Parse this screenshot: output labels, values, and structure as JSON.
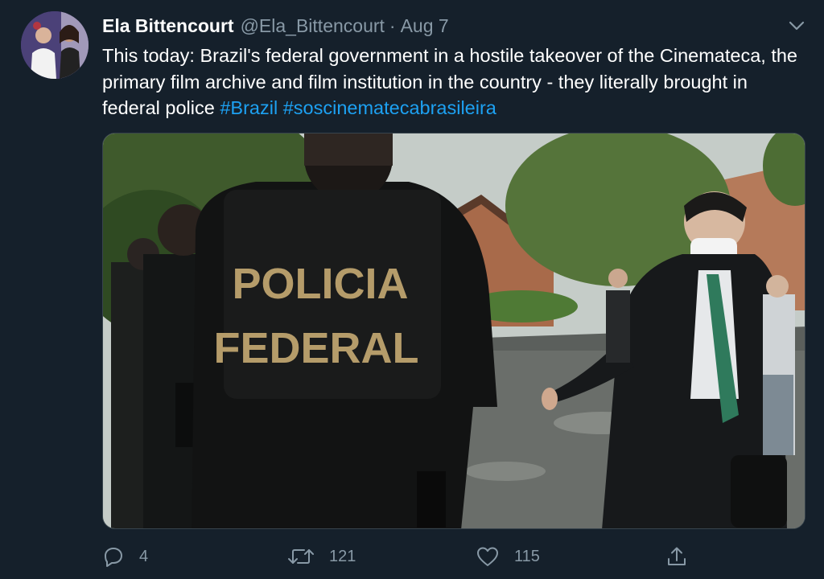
{
  "tweet": {
    "author_name": "Ela Bittencourt",
    "author_handle": "@Ela_Bittencourt",
    "separator": "·",
    "date": "Aug 7",
    "text_main": "This today: Brazil's federal government in a hostile takeover of the Cinemateca, the primary film archive and film institution in the country - they literally brought in federal police ",
    "hashtags": [
      "#Brazil",
      "#soscinematecabrasileira"
    ],
    "media": {
      "vest_text_line1": "POLICIA",
      "vest_text_line2": "FEDERAL"
    },
    "actions": {
      "reply": {
        "icon": "reply-icon",
        "count": "4"
      },
      "retweet": {
        "icon": "retweet-icon",
        "count": "121"
      },
      "like": {
        "icon": "heart-icon",
        "count": "115"
      },
      "share": {
        "icon": "share-icon"
      }
    }
  },
  "colors": {
    "background": "#15202b",
    "text": "#ffffff",
    "secondary": "#8899a6",
    "link": "#1da1f2"
  }
}
